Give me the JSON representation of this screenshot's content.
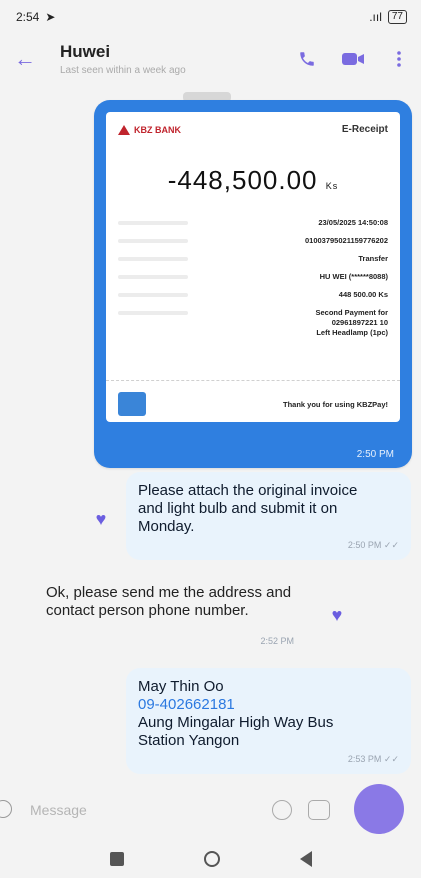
{
  "status_bar": {
    "time": "2:54",
    "signal": ".ııl ",
    "battery": "77"
  },
  "header": {
    "contact_name": "Huwei",
    "last_seen": "Last seen within a week ago"
  },
  "receipt": {
    "bank_name": "KBZ BANK",
    "title": "E-Receipt",
    "amount": "-448,500.00",
    "amount_unit": "Ks",
    "rows": [
      {
        "value": "23/05/2025 14:50:08"
      },
      {
        "value": "01003795021159776202"
      },
      {
        "value": "Transfer"
      },
      {
        "value": "HU WEI (******8088)"
      },
      {
        "value": "448 500.00 Ks"
      },
      {
        "value": "Second Payment for\n02961897221 10\nLeft Headlamp (1pc)"
      }
    ],
    "thanks": "Thank you for using KBZPay!",
    "time": "2:50 PM"
  },
  "messages": [
    {
      "text": "Please attach the original invoice and light bulb and submit it on Monday.",
      "time": "2:50 PM ✓✓"
    },
    {
      "text": "Ok, please send me the address and contact person phone number.",
      "time": "2:52 PM"
    },
    {
      "name_line": "May Thin Oo",
      "phone": "09-402662181",
      "address": "Aung Mingalar High Way Bus Station Yangon",
      "time": "2:53 PM ✓✓"
    }
  ],
  "compose": {
    "placeholder": "Message"
  }
}
